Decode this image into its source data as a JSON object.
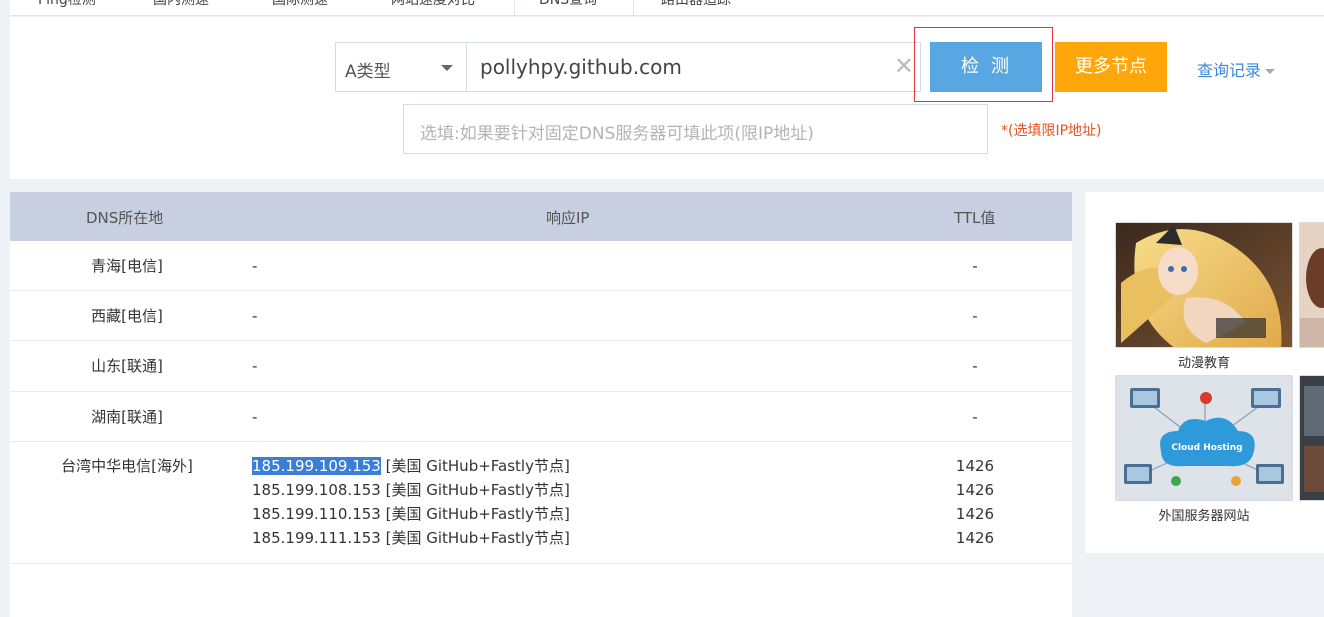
{
  "tabs": [
    {
      "label": "Ping检测"
    },
    {
      "label": "国内测速"
    },
    {
      "label": "国际测速"
    },
    {
      "label": "网站速度对比"
    },
    {
      "label": "DNS查询",
      "active": true
    },
    {
      "label": "路由器追踪"
    }
  ],
  "search": {
    "record_type": "A类型",
    "domain": "pollyhpy.github.com",
    "check_button": "检测",
    "more_button": "更多节点",
    "history_link": "查询记录",
    "dns_placeholder": "选填:如果要针对固定DNS服务器可填此项(限IP地址)",
    "dns_hint": "*(选填限IP地址)"
  },
  "table": {
    "headers": {
      "location": "DNS所在地",
      "ip": "响应IP",
      "ttl": "TTL值"
    },
    "rows": [
      {
        "location": "青海[电信]",
        "ip": "-",
        "ttl": "-"
      },
      {
        "location": "西藏[电信]",
        "ip": "-",
        "ttl": "-"
      },
      {
        "location": "山东[联通]",
        "ip": "-",
        "ttl": "-"
      },
      {
        "location": "湖南[联通]",
        "ip": "-",
        "ttl": "-"
      }
    ],
    "multi_row": {
      "location": "台湾中华电信[海外]",
      "entries": [
        {
          "ip": "185.199.109.153",
          "tag": "[美国 GitHub+Fastly节点]",
          "ttl": "1426",
          "selected": true
        },
        {
          "ip": "185.199.108.153",
          "tag": "[美国 GitHub+Fastly节点]",
          "ttl": "1426"
        },
        {
          "ip": "185.199.110.153",
          "tag": "[美国 GitHub+Fastly节点]",
          "ttl": "1426"
        },
        {
          "ip": "185.199.111.153",
          "tag": "[美国 GitHub+Fastly节点]",
          "ttl": "1426"
        }
      ]
    }
  },
  "ads": [
    {
      "caption": "动漫教育"
    },
    {
      "caption": "外国服务器网站",
      "image_text": "Cloud Hosting"
    }
  ],
  "colors": {
    "check_button": "#59a7e2",
    "more_button": "#ffa70a",
    "table_header": "#c8cfe0",
    "highlight_border": "#e0353b",
    "hint": "#e8501f",
    "link": "#3c8ad7"
  }
}
